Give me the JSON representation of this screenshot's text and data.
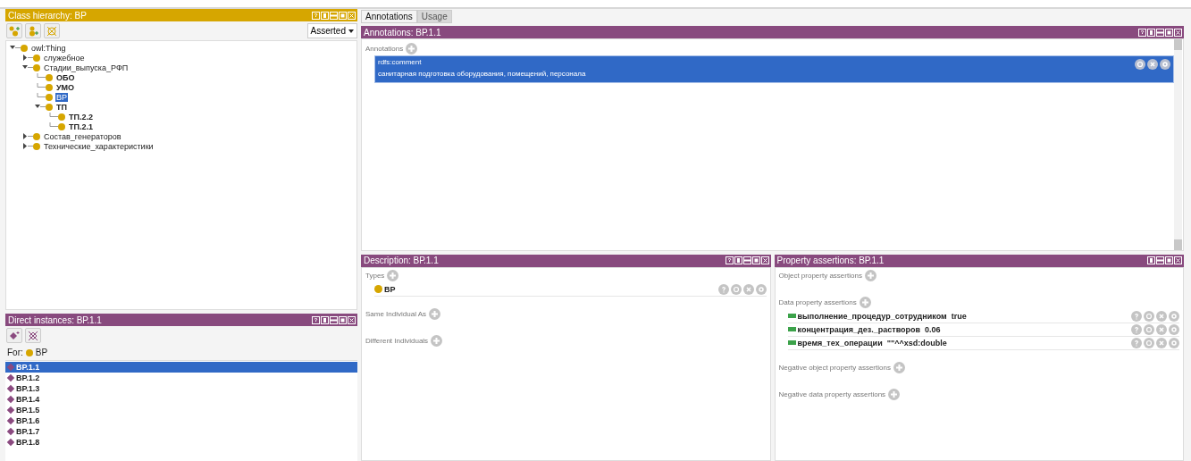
{
  "class_hierarchy": {
    "title": "Class hierarchy: ВР",
    "view_selector": "Asserted",
    "tree": [
      {
        "label": "owl:Thing",
        "expanded": true,
        "bold": false,
        "selected": false,
        "children": [
          {
            "label": "служебное",
            "expanded": false,
            "bold": false,
            "selected": false
          },
          {
            "label": "Стадии_выпуска_РФП",
            "expanded": true,
            "bold": false,
            "selected": false,
            "children": [
              {
                "label": "ОБО",
                "bold": true,
                "selected": false
              },
              {
                "label": "УМО",
                "bold": true,
                "selected": false
              },
              {
                "label": "ВР",
                "bold": false,
                "selected": true
              },
              {
                "label": "ТП",
                "expanded": true,
                "bold": true,
                "selected": false,
                "children": [
                  {
                    "label": "ТП.2.2",
                    "bold": true,
                    "selected": false
                  },
                  {
                    "label": "ТП.2.1",
                    "bold": true,
                    "selected": false
                  }
                ]
              }
            ]
          },
          {
            "label": "Состав_генераторов",
            "expanded": false,
            "bold": false,
            "selected": false
          },
          {
            "label": "Технические_характеристики",
            "expanded": false,
            "bold": false,
            "selected": false
          }
        ]
      }
    ]
  },
  "direct_instances": {
    "title": "Direct instances: ВР.1.1",
    "for_label": "For:",
    "for_class": "ВР",
    "items": [
      {
        "label": "ВР.1.1",
        "selected": true
      },
      {
        "label": "ВР.1.2",
        "selected": false
      },
      {
        "label": "ВР.1.3",
        "selected": false
      },
      {
        "label": "ВР.1.4",
        "selected": false
      },
      {
        "label": "ВР.1.5",
        "selected": false
      },
      {
        "label": "ВР.1.6",
        "selected": false
      },
      {
        "label": "ВР.1.7",
        "selected": false
      },
      {
        "label": "ВР.1.8",
        "selected": false
      }
    ]
  },
  "tabs": [
    {
      "label": "Annotations",
      "selected": true
    },
    {
      "label": "Usage",
      "selected": false
    }
  ],
  "annotations": {
    "title": "Annotations: ВР.1.1",
    "section": "Annotations",
    "items": [
      {
        "property": "rdfs:comment",
        "value": "санитарная подготовка оборудования, помещений, персонала",
        "selected": true
      }
    ]
  },
  "description": {
    "title": "Description: ВР.1.1",
    "sections": [
      {
        "label": "Types",
        "items": [
          {
            "label": "ВР",
            "kind": "class"
          }
        ]
      },
      {
        "label": "Same Individual As"
      },
      {
        "label": "Different Individuals"
      }
    ]
  },
  "property_assertions": {
    "title": "Property assertions: ВР.1.1",
    "sections": [
      {
        "label": "Object property assertions"
      },
      {
        "label": "Data property assertions",
        "items": [
          {
            "label": "выполнение_процедур_сотрудником  true",
            "kind": "data"
          },
          {
            "label": "концентрация_дез._растворов  0.06",
            "kind": "data"
          },
          {
            "label": "время_тех_операции  \"\"^^xsd:double",
            "kind": "data"
          }
        ]
      },
      {
        "label": "Negative object property assertions"
      },
      {
        "label": "Negative data property assertions"
      }
    ]
  }
}
